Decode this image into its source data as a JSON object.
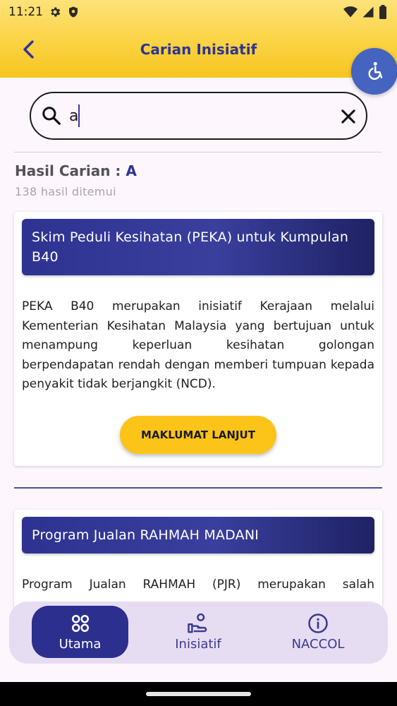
{
  "status": {
    "time": "11:21"
  },
  "header": {
    "title": "Carian Inisiatif"
  },
  "search": {
    "value": "a",
    "placeholder": ""
  },
  "results": {
    "label": "Hasil Carian :",
    "query": "A",
    "count_text": "138 hasil ditemui"
  },
  "cards": [
    {
      "title": "Skim Peduli Kesihatan (PEKA) untuk Kumpulan B40",
      "description": "PEKA B40 merupakan inisiatif Kerajaan melalui Kementerian Kesihatan Malaysia yang bertujuan untuk menampung keperluan kesihatan golongan berpendapatan rendah dengan memberi tumpuan kepada penyakit tidak berjangkit (NCD).",
      "button": "MAKLUMAT LANJUT"
    },
    {
      "title": "Program Jualan RAHMAH MADANI",
      "description": "Program Jualan RAHMAH (PJR) merupakan salah"
    }
  ],
  "nav": {
    "items": [
      {
        "label": "Utama",
        "icon": "grid-icon",
        "active": true
      },
      {
        "label": "Inisiatif",
        "icon": "hand-icon",
        "active": false
      },
      {
        "label": "NACCOL",
        "icon": "info-icon",
        "active": false
      }
    ]
  },
  "colors": {
    "primary": "#2d3494",
    "accent": "#fcc419",
    "appbar": "#fbd447",
    "fab": "#4464bf"
  }
}
